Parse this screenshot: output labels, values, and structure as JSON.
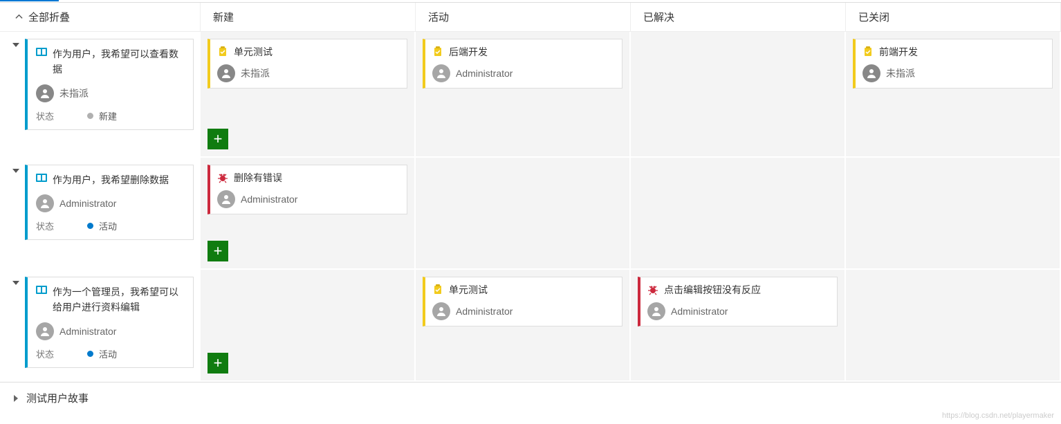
{
  "header": {
    "collapse_all": "全部折叠"
  },
  "columns": [
    "新建",
    "活动",
    "已解决",
    "已关闭"
  ],
  "state_label": "状态",
  "states": {
    "new": "新建",
    "active": "活动"
  },
  "assignees": {
    "unassigned": "未指派",
    "admin": "Administrator"
  },
  "rows": [
    {
      "story": {
        "title": "作为用户，我希望可以查看数据",
        "assignee": "unassigned",
        "state": "new"
      },
      "lanes": {
        "new": [
          {
            "type": "task",
            "title": "单元测试",
            "assignee": "unassigned"
          }
        ],
        "active": [
          {
            "type": "task",
            "title": "后端开发",
            "assignee": "admin"
          }
        ],
        "resolved": [],
        "closed": [
          {
            "type": "task",
            "title": "前端开发",
            "assignee": "unassigned"
          }
        ]
      }
    },
    {
      "story": {
        "title": "作为用户，我希望删除数据",
        "assignee": "admin",
        "state": "active"
      },
      "lanes": {
        "new": [
          {
            "type": "bug",
            "title": "删除有错误",
            "assignee": "admin"
          }
        ],
        "active": [],
        "resolved": [],
        "closed": []
      }
    },
    {
      "story": {
        "title": "作为一个管理员，我希望可以给用户进行资料编辑",
        "assignee": "admin",
        "state": "active"
      },
      "lanes": {
        "new": [],
        "active": [
          {
            "type": "task",
            "title": "单元测试",
            "assignee": "admin"
          }
        ],
        "resolved": [
          {
            "type": "bug",
            "title": "点击编辑按钮没有反应",
            "assignee": "admin"
          }
        ],
        "closed": []
      }
    }
  ],
  "footer": {
    "test_stories": "测试用户故事"
  },
  "watermark": "https://blog.csdn.net/playermaker"
}
